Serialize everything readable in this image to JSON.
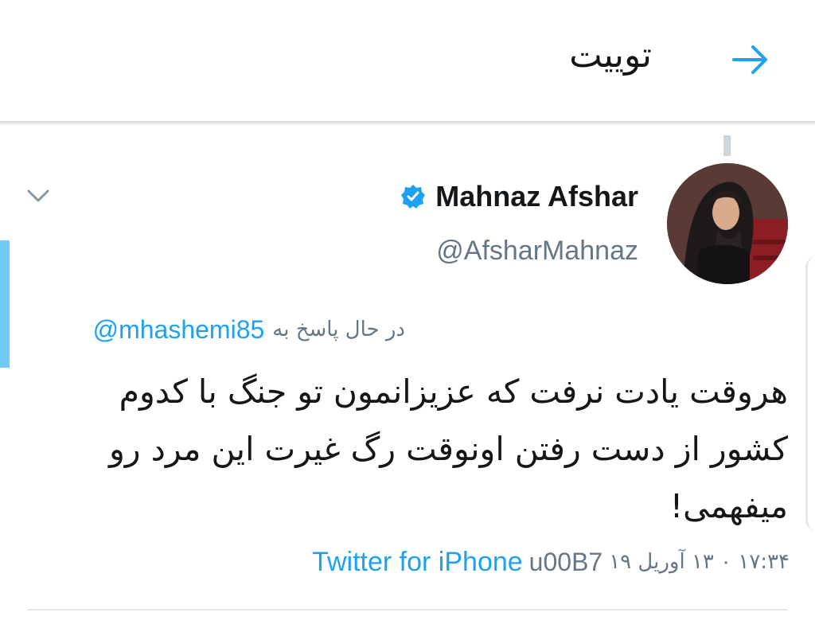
{
  "header": {
    "title": "توییت",
    "back_icon": "arrow-right-icon",
    "accent_color": "#1da1f2"
  },
  "tweet": {
    "author": {
      "display_name": "Mahnaz Afshar",
      "handle": "@AfsharMahnaz",
      "verified_icon": "verified-badge-icon",
      "avatar": "avatar-photo"
    },
    "menu_icon": "chevron-down-icon",
    "reply_prefix": "در حال پاسخ به",
    "reply_to": "@mhashemi85",
    "text": "هروقت یادت نرفت که عزیزانمون تو جنگ با کدوم کشور از دست رفتن اونوقت رگ غیرت این مرد رو میفهمی!",
    "timestamp": "۱۷:۳۴ ۰ ۱۳ آوریل ۱۹",
    "separator": "u00B7",
    "source": "Twitter for iPhone"
  },
  "colors": {
    "link": "#1da1f2",
    "secondary_text": "#657786",
    "divider": "#e1e8ed",
    "thread_accent": "#71c9f8"
  }
}
